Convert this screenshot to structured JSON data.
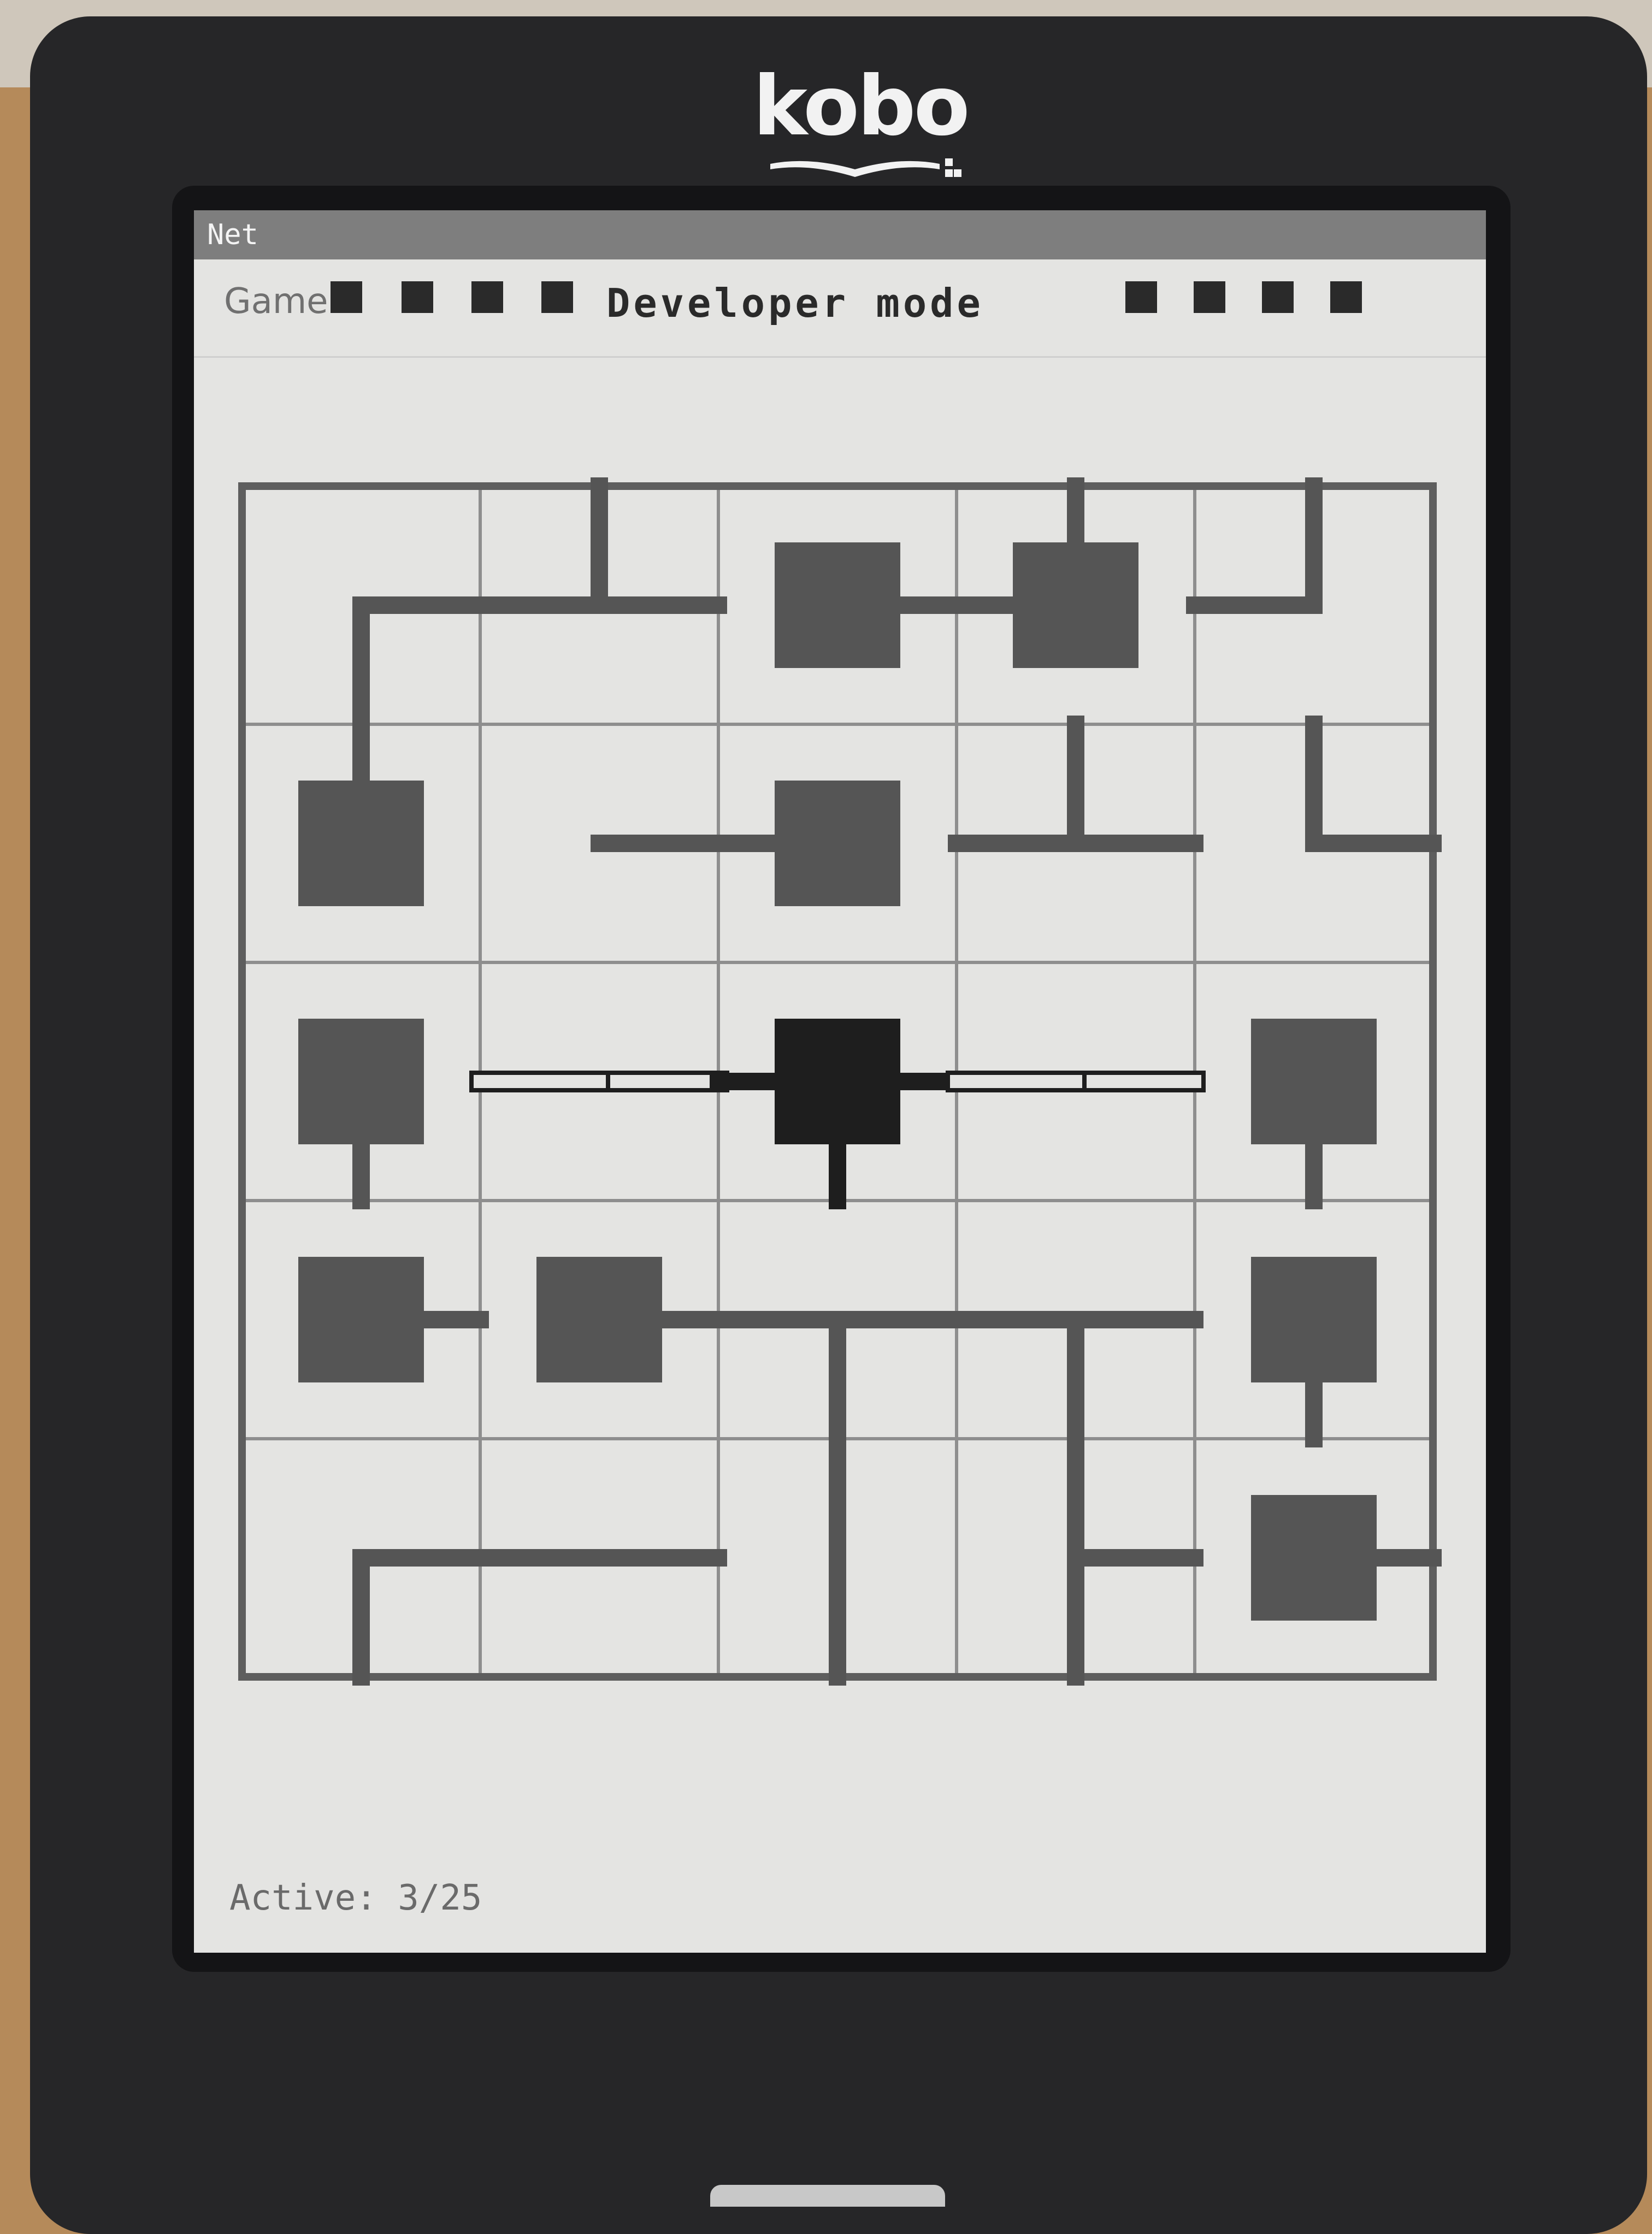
{
  "device": {
    "brand": "kobo"
  },
  "app": {
    "title": "Net"
  },
  "menu": {
    "game_label": "Game",
    "mode_label": "Developer mode"
  },
  "status": {
    "text": "Active: 3/25"
  },
  "colors": {
    "screen": "#e4e4e2",
    "grid_line": "#8e8e8e",
    "border": "#5e5e5e",
    "pipe_inactive": "#555555",
    "pipe_active": "#1e1e1e",
    "node_inactive": "#555555",
    "node_active": "#1e1e1e"
  },
  "board": {
    "cols": 5,
    "rows": 5,
    "tiles": [
      [
        {
          "links": [
            "E"
          ],
          "corner": "SE",
          "node": false
        },
        {
          "links": [
            "N",
            "E",
            "W"
          ],
          "node": false
        },
        {
          "links": [
            "E"
          ],
          "node": true
        },
        {
          "links": [
            "N",
            "W"
          ],
          "node": true
        },
        {
          "links": [
            "N",
            "W"
          ],
          "node": false
        }
      ],
      [
        {
          "links": [
            "N"
          ],
          "node": true
        },
        {
          "links": [
            "E"
          ],
          "node": false
        },
        {
          "links": [
            "W"
          ],
          "node": true
        },
        {
          "links": [
            "N",
            "E",
            "W"
          ],
          "node": false
        },
        {
          "links": [
            "N",
            "E"
          ],
          "node": false
        }
      ],
      [
        {
          "links": [
            "S"
          ],
          "node": true
        },
        {
          "links": [
            "E",
            "W"
          ],
          "node": false,
          "active": true
        },
        {
          "links": [
            "E",
            "W",
            "S"
          ],
          "node": true,
          "active": true
        },
        {
          "links": [
            "E",
            "W"
          ],
          "node": false,
          "active": true
        },
        {
          "links": [
            "S"
          ],
          "node": true
        }
      ],
      [
        {
          "links": [
            "E"
          ],
          "node": true
        },
        {
          "links": [
            "E"
          ],
          "node": true
        },
        {
          "links": [
            "E",
            "W",
            "S"
          ],
          "node": false
        },
        {
          "links": [
            "E",
            "W",
            "S"
          ],
          "node": false
        },
        {
          "links": [
            "S"
          ],
          "node": true
        }
      ],
      [
        {
          "links": [
            "E",
            "S"
          ],
          "node": false
        },
        {
          "links": [
            "E",
            "W"
          ],
          "node": false
        },
        {
          "links": [
            "N",
            "S"
          ],
          "node": false
        },
        {
          "links": [
            "N",
            "S",
            "E"
          ],
          "node": false
        },
        {
          "links": [
            "E"
          ],
          "node": true
        }
      ]
    ]
  }
}
